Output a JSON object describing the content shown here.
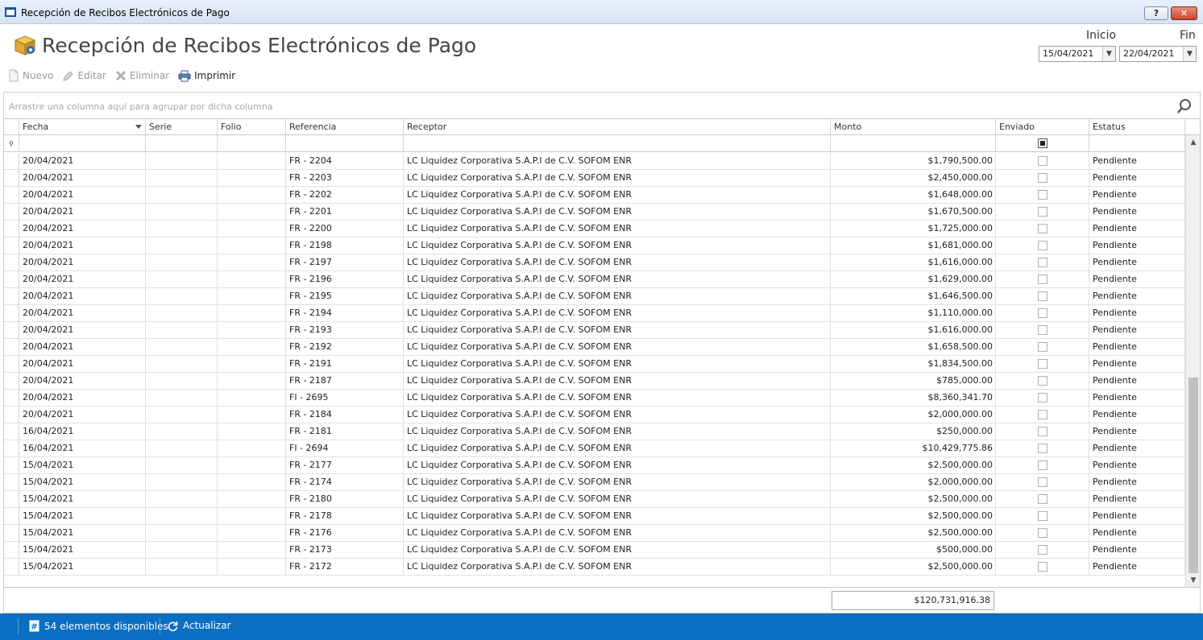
{
  "window": {
    "title": "Recepción de Recibos Electrónicos de Pago",
    "help_label": "?",
    "close_label": "✕"
  },
  "page": {
    "title": "Recepción de Recibos Electrónicos de Pago"
  },
  "dates": {
    "start_label": "Inicio",
    "end_label": "Fin",
    "start_value": "15/04/2021",
    "end_value": "22/04/2021"
  },
  "toolbar": {
    "new_label": "Nuevo",
    "edit_label": "Editar",
    "delete_label": "Eliminar",
    "print_label": "Imprimir"
  },
  "grid": {
    "group_hint": "Arrastre una columna aquí para agrupar por dicha columna",
    "columns": [
      "Fecha",
      "Serie",
      "Folio",
      "Referencia",
      "Receptor",
      "Monto",
      "Enviado",
      "Estatus"
    ],
    "rows": [
      {
        "fecha": "20/04/2021",
        "serie": "",
        "folio": "",
        "referencia": "FR - 2204",
        "receptor": "LC Liquidez Corporativa S.A.P.I de C.V. SOFOM ENR",
        "monto": "$1,790,500.00",
        "enviado": false,
        "estatus": "Pendiente"
      },
      {
        "fecha": "20/04/2021",
        "serie": "",
        "folio": "",
        "referencia": "FR - 2203",
        "receptor": "LC Liquidez Corporativa S.A.P.I de C.V. SOFOM ENR",
        "monto": "$2,450,000.00",
        "enviado": false,
        "estatus": "Pendiente"
      },
      {
        "fecha": "20/04/2021",
        "serie": "",
        "folio": "",
        "referencia": "FR - 2202",
        "receptor": "LC Liquidez Corporativa S.A.P.I de C.V. SOFOM ENR",
        "monto": "$1,648,000.00",
        "enviado": false,
        "estatus": "Pendiente"
      },
      {
        "fecha": "20/04/2021",
        "serie": "",
        "folio": "",
        "referencia": "FR - 2201",
        "receptor": "LC Liquidez Corporativa S.A.P.I de C.V. SOFOM ENR",
        "monto": "$1,670,500.00",
        "enviado": false,
        "estatus": "Pendiente"
      },
      {
        "fecha": "20/04/2021",
        "serie": "",
        "folio": "",
        "referencia": "FR - 2200",
        "receptor": "LC Liquidez Corporativa S.A.P.I de C.V. SOFOM ENR",
        "monto": "$1,725,000.00",
        "enviado": false,
        "estatus": "Pendiente"
      },
      {
        "fecha": "20/04/2021",
        "serie": "",
        "folio": "",
        "referencia": "FR - 2198",
        "receptor": "LC Liquidez Corporativa S.A.P.I de C.V. SOFOM ENR",
        "monto": "$1,681,000.00",
        "enviado": false,
        "estatus": "Pendiente"
      },
      {
        "fecha": "20/04/2021",
        "serie": "",
        "folio": "",
        "referencia": "FR - 2197",
        "receptor": "LC Liquidez Corporativa S.A.P.I de C.V. SOFOM ENR",
        "monto": "$1,616,000.00",
        "enviado": false,
        "estatus": "Pendiente"
      },
      {
        "fecha": "20/04/2021",
        "serie": "",
        "folio": "",
        "referencia": "FR - 2196",
        "receptor": "LC Liquidez Corporativa S.A.P.I de C.V. SOFOM ENR",
        "monto": "$1,629,000.00",
        "enviado": false,
        "estatus": "Pendiente"
      },
      {
        "fecha": "20/04/2021",
        "serie": "",
        "folio": "",
        "referencia": "FR - 2195",
        "receptor": "LC Liquidez Corporativa S.A.P.I de C.V. SOFOM ENR",
        "monto": "$1,646,500.00",
        "enviado": false,
        "estatus": "Pendiente"
      },
      {
        "fecha": "20/04/2021",
        "serie": "",
        "folio": "",
        "referencia": "FR - 2194",
        "receptor": "LC Liquidez Corporativa S.A.P.I de C.V. SOFOM ENR",
        "monto": "$1,110,000.00",
        "enviado": false,
        "estatus": "Pendiente"
      },
      {
        "fecha": "20/04/2021",
        "serie": "",
        "folio": "",
        "referencia": "FR - 2193",
        "receptor": "LC Liquidez Corporativa S.A.P.I de C.V. SOFOM ENR",
        "monto": "$1,616,000.00",
        "enviado": false,
        "estatus": "Pendiente"
      },
      {
        "fecha": "20/04/2021",
        "serie": "",
        "folio": "",
        "referencia": "FR - 2192",
        "receptor": "LC Liquidez Corporativa S.A.P.I de C.V. SOFOM ENR",
        "monto": "$1,658,500.00",
        "enviado": false,
        "estatus": "Pendiente"
      },
      {
        "fecha": "20/04/2021",
        "serie": "",
        "folio": "",
        "referencia": "FR - 2191",
        "receptor": "LC Liquidez Corporativa S.A.P.I de C.V. SOFOM ENR",
        "monto": "$1,834,500.00",
        "enviado": false,
        "estatus": "Pendiente"
      },
      {
        "fecha": "20/04/2021",
        "serie": "",
        "folio": "",
        "referencia": "FR - 2187",
        "receptor": "LC Liquidez Corporativa S.A.P.I de C.V. SOFOM ENR",
        "monto": "$785,000.00",
        "enviado": false,
        "estatus": "Pendiente"
      },
      {
        "fecha": "20/04/2021",
        "serie": "",
        "folio": "",
        "referencia": "FI - 2695",
        "receptor": "LC Liquidez Corporativa S.A.P.I de C.V. SOFOM ENR",
        "monto": "$8,360,341.70",
        "enviado": false,
        "estatus": "Pendiente"
      },
      {
        "fecha": "20/04/2021",
        "serie": "",
        "folio": "",
        "referencia": "FR - 2184",
        "receptor": "LC Liquidez Corporativa S.A.P.I de C.V. SOFOM ENR",
        "monto": "$2,000,000.00",
        "enviado": false,
        "estatus": "Pendiente"
      },
      {
        "fecha": "16/04/2021",
        "serie": "",
        "folio": "",
        "referencia": "FR - 2181",
        "receptor": "LC Liquidez Corporativa S.A.P.I de C.V. SOFOM ENR",
        "monto": "$250,000.00",
        "enviado": false,
        "estatus": "Pendiente"
      },
      {
        "fecha": "16/04/2021",
        "serie": "",
        "folio": "",
        "referencia": "FI - 2694",
        "receptor": "LC Liquidez Corporativa S.A.P.I de C.V. SOFOM ENR",
        "monto": "$10,429,775.86",
        "enviado": false,
        "estatus": "Pendiente"
      },
      {
        "fecha": "15/04/2021",
        "serie": "",
        "folio": "",
        "referencia": "FR - 2177",
        "receptor": "LC Liquidez Corporativa S.A.P.I de C.V. SOFOM ENR",
        "monto": "$2,500,000.00",
        "enviado": false,
        "estatus": "Pendiente"
      },
      {
        "fecha": "15/04/2021",
        "serie": "",
        "folio": "",
        "referencia": "FR - 2174",
        "receptor": "LC Liquidez Corporativa S.A.P.I de C.V. SOFOM ENR",
        "monto": "$2,000,000.00",
        "enviado": false,
        "estatus": "Pendiente"
      },
      {
        "fecha": "15/04/2021",
        "serie": "",
        "folio": "",
        "referencia": "FR - 2180",
        "receptor": "LC Liquidez Corporativa S.A.P.I de C.V. SOFOM ENR",
        "monto": "$2,500,000.00",
        "enviado": false,
        "estatus": "Pendiente"
      },
      {
        "fecha": "15/04/2021",
        "serie": "",
        "folio": "",
        "referencia": "FR - 2178",
        "receptor": "LC Liquidez Corporativa S.A.P.I de C.V. SOFOM ENR",
        "monto": "$2,500,000.00",
        "enviado": false,
        "estatus": "Pendiente"
      },
      {
        "fecha": "15/04/2021",
        "serie": "",
        "folio": "",
        "referencia": "FR - 2176",
        "receptor": "LC Liquidez Corporativa S.A.P.I de C.V. SOFOM ENR",
        "monto": "$2,500,000.00",
        "enviado": false,
        "estatus": "Pendiente"
      },
      {
        "fecha": "15/04/2021",
        "serie": "",
        "folio": "",
        "referencia": "FR - 2173",
        "receptor": "LC Liquidez Corporativa S.A.P.I de C.V. SOFOM ENR",
        "monto": "$500,000.00",
        "enviado": false,
        "estatus": "Pendiente"
      },
      {
        "fecha": "15/04/2021",
        "serie": "",
        "folio": "",
        "referencia": "FR - 2172",
        "receptor": "LC Liquidez Corporativa S.A.P.I de C.V. SOFOM ENR",
        "monto": "$2,500,000.00",
        "enviado": false,
        "estatus": "Pendiente"
      }
    ],
    "total_monto": "$120,731,916.38"
  },
  "status": {
    "count_label": "54 elementos disponibles",
    "refresh_label": "Actualizar"
  },
  "colors": {
    "statusbar": "#0a6fc2",
    "close_button": "#c9442d"
  },
  "icons": {
    "app": "window-icon",
    "header": "package-box-icon",
    "new": "document-icon",
    "edit": "pencil-icon",
    "delete": "x-icon",
    "print": "printer-icon",
    "search": "search-icon",
    "count": "hash-icon",
    "refresh": "refresh-icon"
  }
}
